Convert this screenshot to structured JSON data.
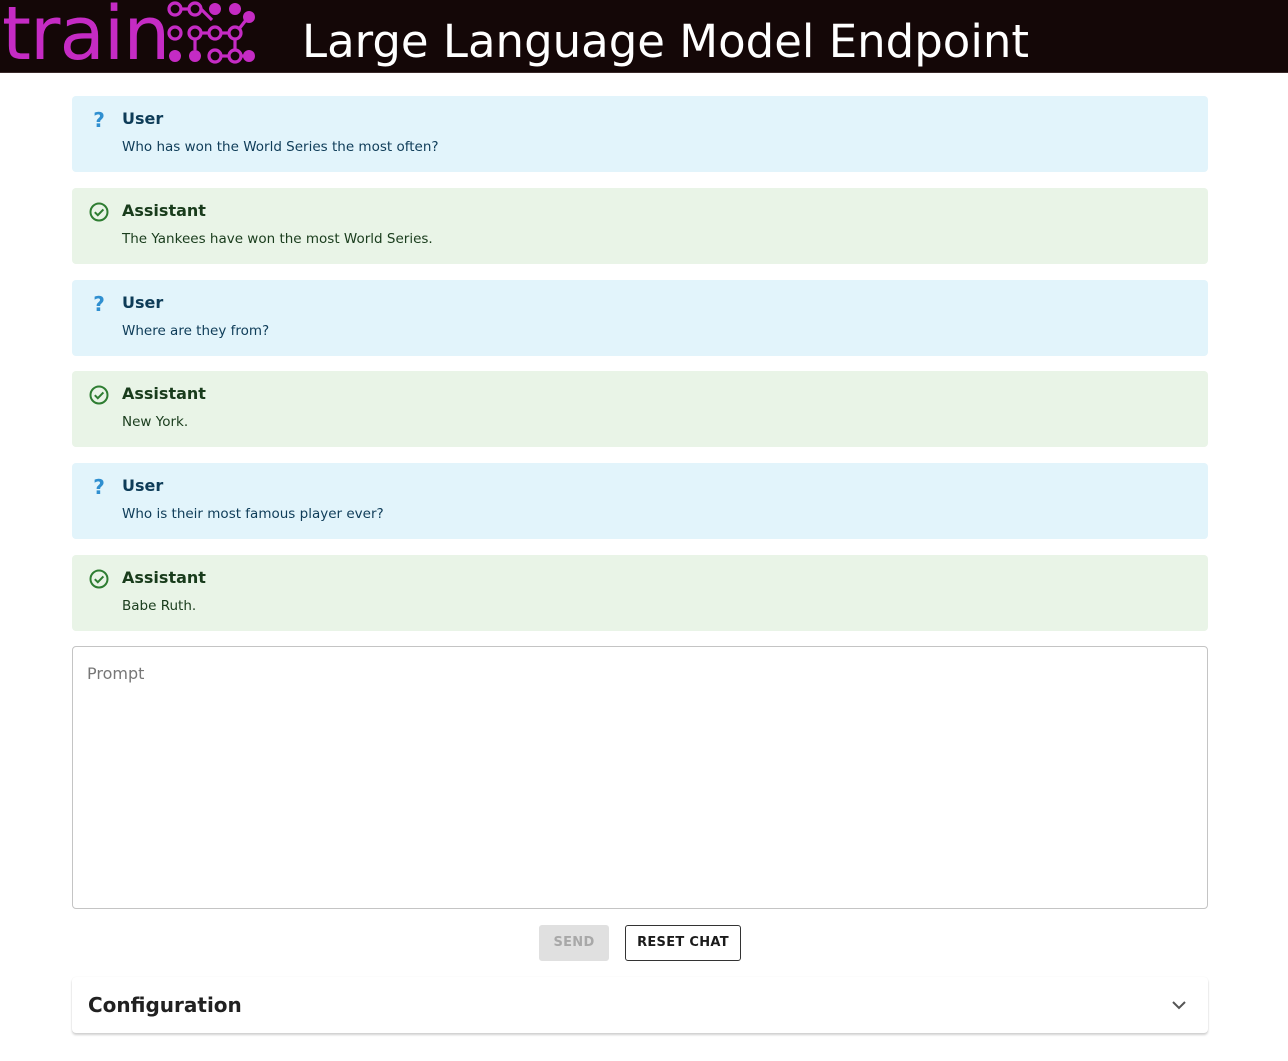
{
  "header": {
    "logo_text": "train",
    "title": "Large Language Model Endpoint",
    "brand_color": "#c52bc4",
    "background": "#140707"
  },
  "chat": {
    "messages": [
      {
        "role": "User",
        "text": "Who has won the World Series the most often?",
        "icon": "question-icon"
      },
      {
        "role": "Assistant",
        "text": "The Yankees have won the most World Series.",
        "icon": "check-circle-icon"
      },
      {
        "role": "User",
        "text": "Where are they from?",
        "icon": "question-icon"
      },
      {
        "role": "Assistant",
        "text": "New York.",
        "icon": "check-circle-icon"
      },
      {
        "role": "User",
        "text": "Who is their most famous player ever?",
        "icon": "question-icon"
      },
      {
        "role": "Assistant",
        "text": "Babe Ruth.",
        "icon": "check-circle-icon"
      }
    ],
    "user_color": "#e2f4fb",
    "assistant_color": "#e9f4e7"
  },
  "prompt": {
    "placeholder": "Prompt",
    "value": ""
  },
  "actions": {
    "send_label": "SEND",
    "reset_label": "RESET CHAT"
  },
  "config": {
    "title": "Configuration",
    "icon": "chevron-down-icon"
  }
}
